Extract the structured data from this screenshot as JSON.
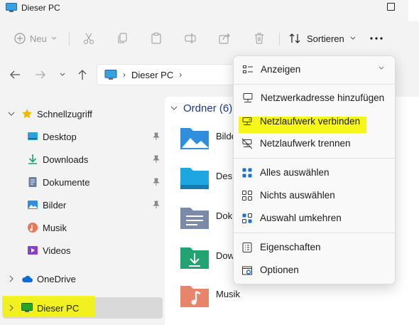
{
  "window": {
    "title": "Dieser PC"
  },
  "toolbar": {
    "new_label": "Neu",
    "sort_label": "Sortieren"
  },
  "address": {
    "crumbs": [
      "Dieser PC"
    ]
  },
  "sidebar": {
    "items": [
      {
        "label": "Schnellzugriff"
      },
      {
        "label": "Desktop"
      },
      {
        "label": "Downloads"
      },
      {
        "label": "Dokumente"
      },
      {
        "label": "Bilder"
      },
      {
        "label": "Musik"
      },
      {
        "label": "Videos"
      },
      {
        "label": "OneDrive"
      },
      {
        "label": "Dieser PC"
      }
    ]
  },
  "main": {
    "group_label": "Ordner (6)",
    "folders": [
      {
        "name": "Bilde"
      },
      {
        "name": "Desk"
      },
      {
        "name": "Doku"
      },
      {
        "name": "Dow"
      },
      {
        "name": "Musik"
      }
    ]
  },
  "menu": {
    "items": [
      {
        "label": "Anzeigen",
        "icon": "view-icon"
      },
      {
        "label": "Netzwerkadresse hinzufügen",
        "icon": "network-location-icon"
      },
      {
        "label": "Netzlaufwerk verbinden",
        "icon": "map-drive-icon"
      },
      {
        "label": "Netzlaufwerk trennen",
        "icon": "disconnect-drive-icon"
      },
      {
        "label": "Alles auswählen",
        "icon": "select-all-icon"
      },
      {
        "label": "Nichts auswählen",
        "icon": "select-none-icon"
      },
      {
        "label": "Auswahl umkehren",
        "icon": "invert-selection-icon"
      },
      {
        "label": "Eigenschaften",
        "icon": "properties-icon"
      },
      {
        "label": "Optionen",
        "icon": "options-icon"
      }
    ]
  },
  "colors": {
    "highlight": "#f5f500",
    "group_header": "#1b3a8a",
    "folder_blue": "#1e90d6"
  }
}
